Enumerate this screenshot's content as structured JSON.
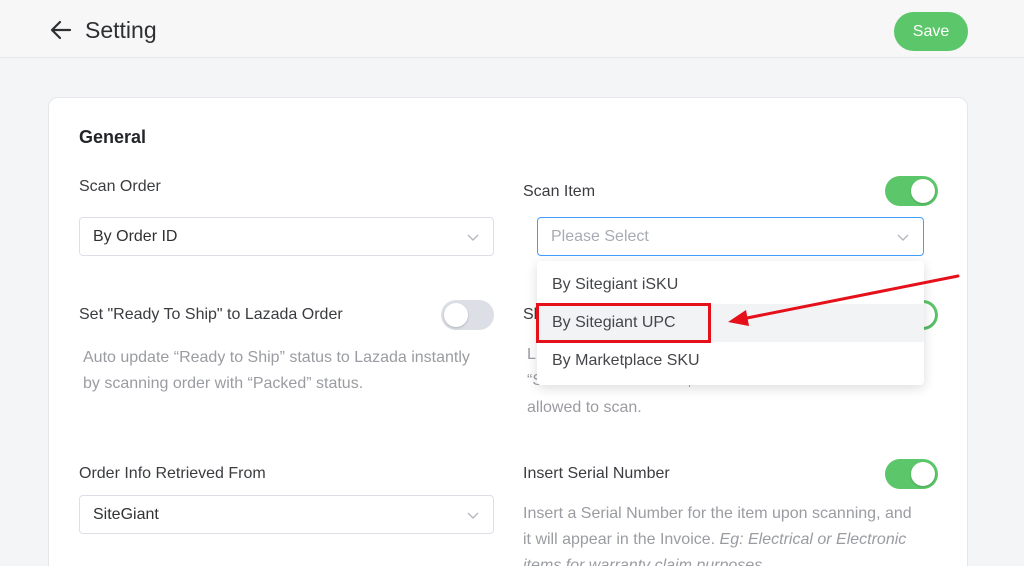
{
  "header": {
    "title": "Setting",
    "save_label": "Save",
    "back_icon": "arrow-left-icon"
  },
  "general": {
    "section_title": "General",
    "scan_order": {
      "label": "Scan Order",
      "value": "By Order ID"
    },
    "scan_item": {
      "label": "Scan Item",
      "enabled": true,
      "placeholder": "Please Select",
      "options": [
        "By Sitegiant iSKU",
        "By Sitegiant UPC",
        "By Marketplace SKU"
      ],
      "hovered_option": "By Sitegiant UPC"
    },
    "ready_to_ship": {
      "label": "Set \"Ready To Ship\" to Lazada Order",
      "enabled": false,
      "desc_line1": "Auto update “Ready to Ship” status to Lazada instantly",
      "desc_line2": "by scanning order with “Packed” status."
    },
    "hidden_setting": {
      "label_fragment": "Sk",
      "enabled": true,
      "desc_fragment1": "L",
      "desc_fragment2": "“Scan Item” is enabled, the individual items are",
      "desc_line3": "allowed to scan."
    },
    "order_info": {
      "label": "Order Info Retrieved From",
      "value": "SiteGiant"
    },
    "serial_number": {
      "label": "Insert Serial Number",
      "enabled": true,
      "desc_line1": "Insert a Serial Number for the item upon scanning, and",
      "desc_line2_plain": "it will appear in the Invoice. ",
      "desc_line2_italic": "Eg: Electrical or Electronic",
      "desc_line3_italic": "items for warranty claim purposes."
    }
  },
  "colors": {
    "accent_green": "#5cc76a",
    "focus_blue": "#409eff",
    "annotation_red": "#e5101a"
  }
}
